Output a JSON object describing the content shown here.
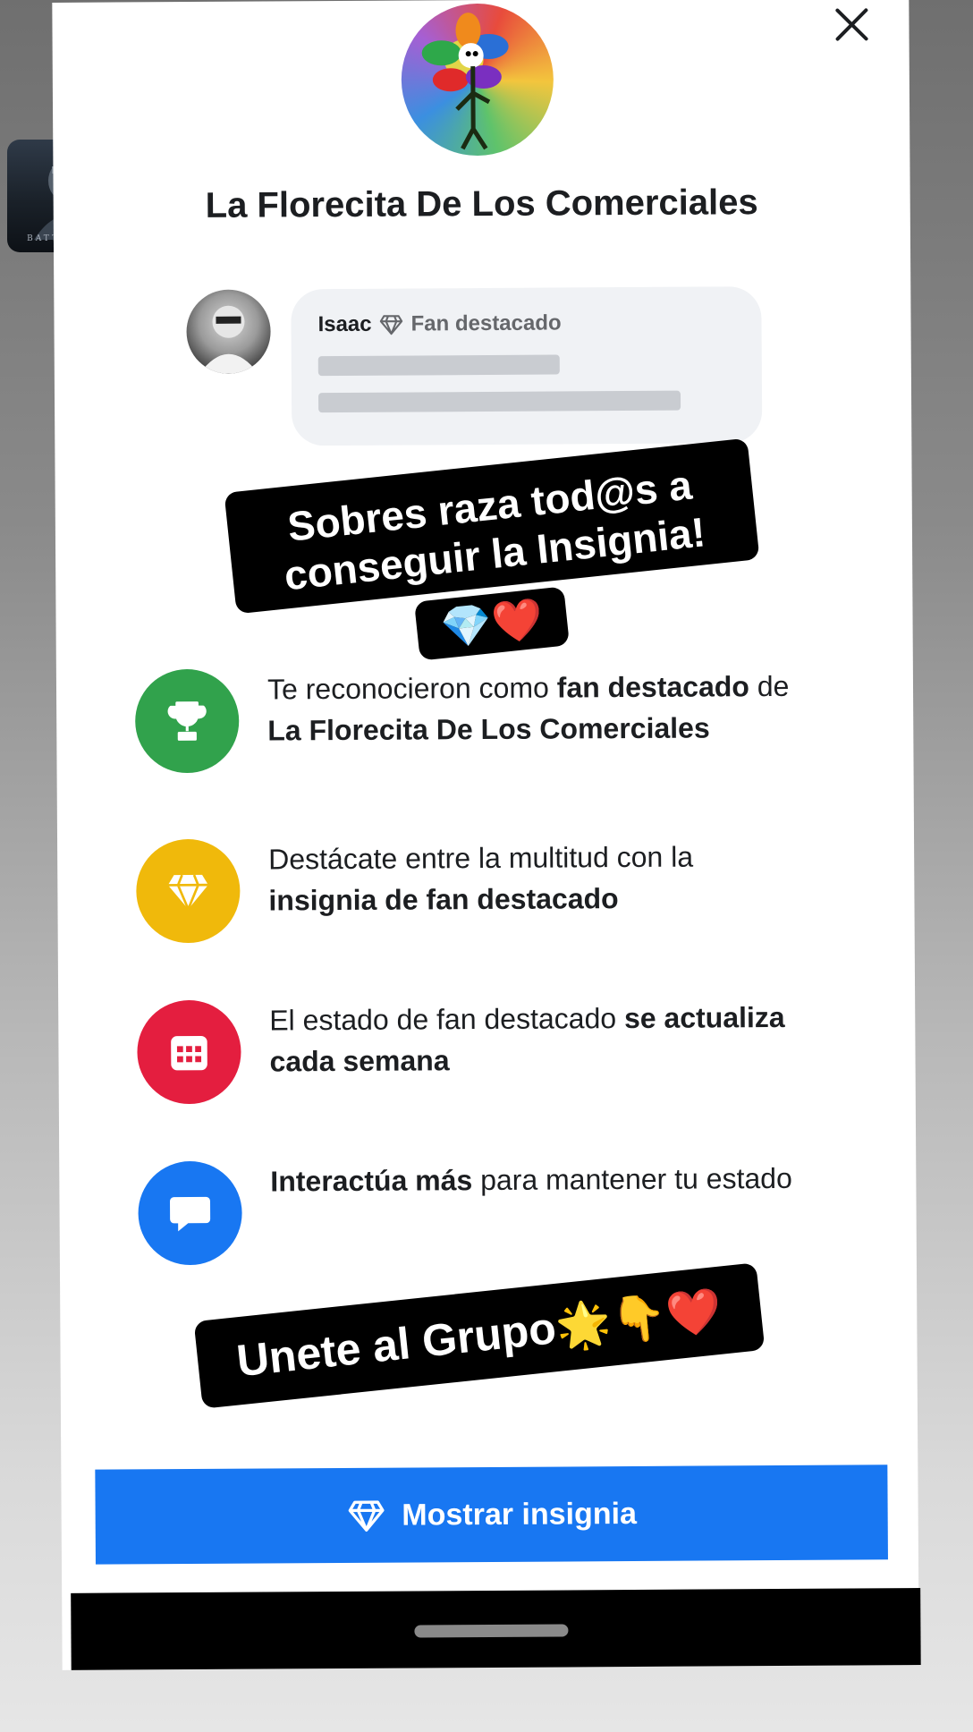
{
  "group": {
    "title": "La Florecita De Los Comerciales"
  },
  "comment_preview": {
    "name": "Isaac",
    "badge": "Fan destacado"
  },
  "overlays": {
    "caption1": "Sobres raza tod@s a conseguir la Insignia!",
    "caption1_emoji": "💎❤️",
    "caption2": "Unete al Grupo🌟👇❤️"
  },
  "thumbnail": {
    "label": "BATTLECRY"
  },
  "features": [
    {
      "icon": "trophy-icon",
      "color": "#31a24c",
      "parts": [
        {
          "t": "Te reconocieron como ",
          "b": false
        },
        {
          "t": "fan destacado",
          "b": true
        },
        {
          "t": " de ",
          "b": false
        },
        {
          "t": "La Florecita De Los Comerciales",
          "b": true
        }
      ]
    },
    {
      "icon": "diamond-icon",
      "color": "#f0b90b",
      "parts": [
        {
          "t": "Destácate entre la multitud con la ",
          "b": false
        },
        {
          "t": "insignia de fan destacado",
          "b": true
        }
      ]
    },
    {
      "icon": "calendar-icon",
      "color": "#e41e3f",
      "parts": [
        {
          "t": "El estado de fan destacado ",
          "b": false
        },
        {
          "t": "se actualiza cada semana",
          "b": true
        }
      ]
    },
    {
      "icon": "chat-bubble-icon",
      "color": "#1877f2",
      "parts": [
        {
          "t": "Interactúa más",
          "b": true
        },
        {
          "t": " para mantener tu estado",
          "b": false
        }
      ]
    }
  ],
  "cta": {
    "label": "Mostrar insignia"
  }
}
